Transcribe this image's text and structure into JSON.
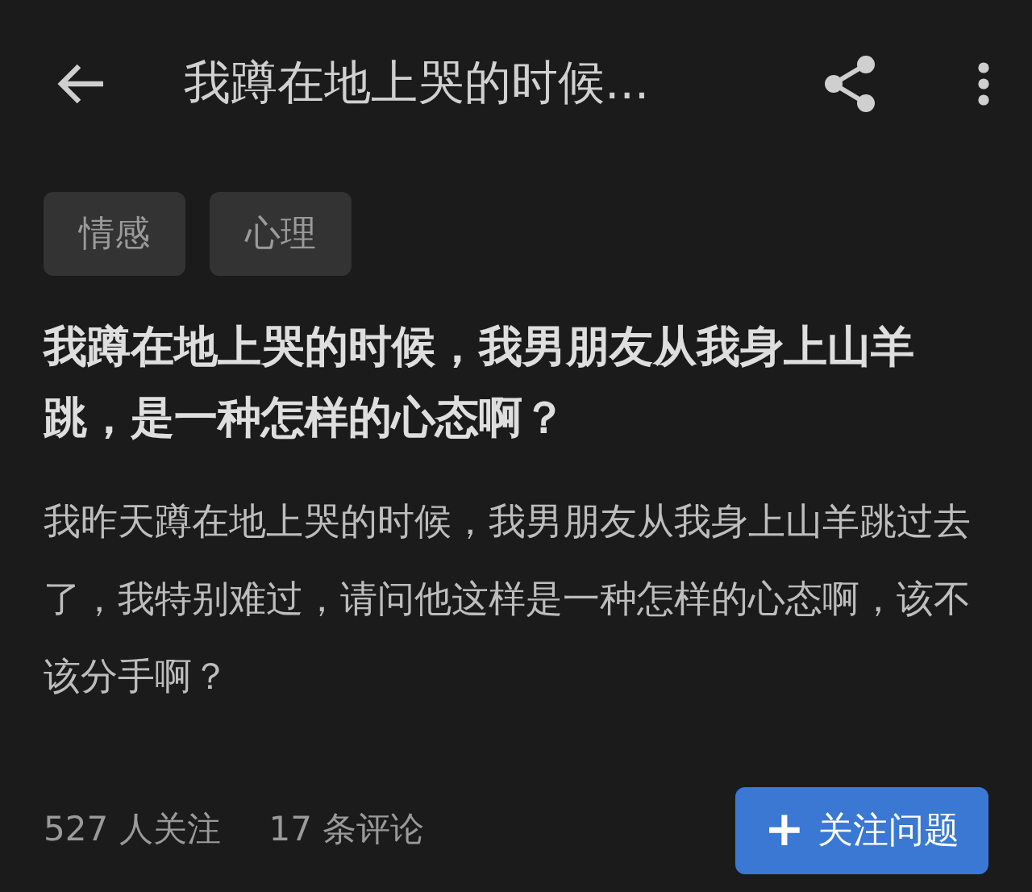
{
  "header": {
    "title": "我蹲在地上哭的时候..."
  },
  "tags": [
    "情感",
    "心理"
  ],
  "question": {
    "title": "我蹲在地上哭的时候，我男朋友从我身上山羊跳，是一种怎样的心态啊？",
    "body": "我昨天蹲在地上哭的时候，我男朋友从我身上山羊跳过去了，我特别难过，请问他这样是一种怎样的心态啊，该不该分手啊？"
  },
  "stats": [
    "527 人关注",
    "17 条评论"
  ],
  "follow_button": {
    "icon": "+",
    "label": "关注问题"
  }
}
